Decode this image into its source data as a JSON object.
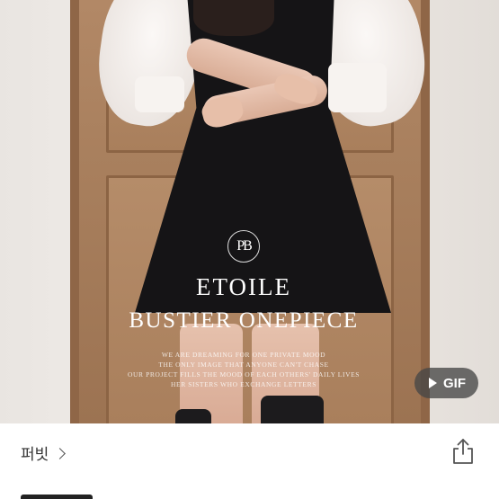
{
  "image": {
    "brand_mark": "PB",
    "product_title_line1": "ETOILE",
    "product_title_line2": "BUSTIER ONEPIECE",
    "tagline_lines": [
      "WE ARE DREAMING FOR ONE PRIVATE MOOD",
      "THE ONLY IMAGE THAT ANYONE CAN'T CHASE",
      "OUR PROJECT FILLS THE MOOD OF EACH OTHERS' DAILY LIVES",
      "HER SISTERS WHO EXCHANGE LETTERS"
    ]
  },
  "gif_badge": {
    "label": "GIF",
    "icon": "play-icon"
  },
  "footer": {
    "shop_name": "퍼빗",
    "shop_chevron_icon": "chevron-right-icon",
    "share_icon": "share-icon"
  }
}
